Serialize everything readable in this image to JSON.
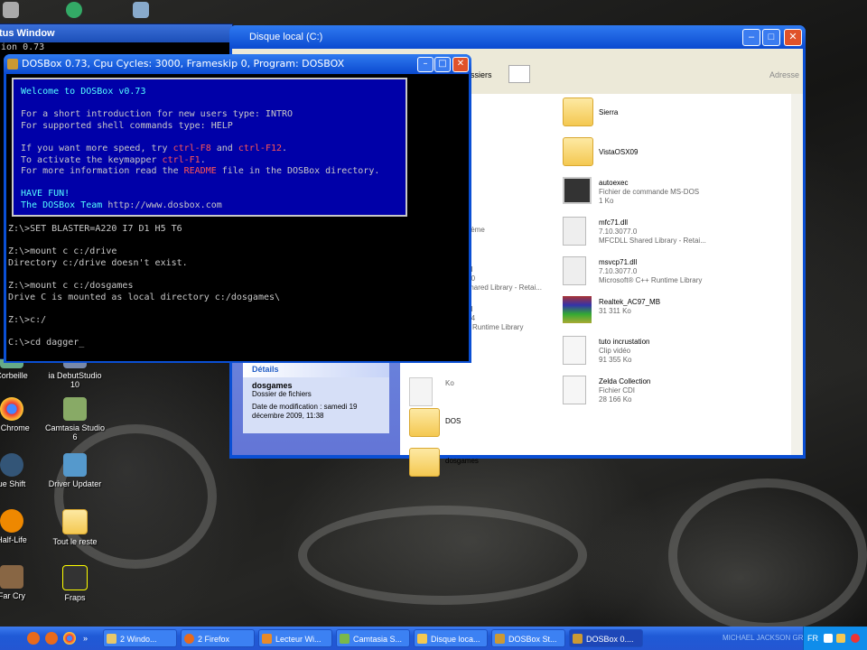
{
  "status_window": {
    "title": "tus Window",
    "line": "ion 0.73"
  },
  "explorer": {
    "title": "Disque local  (C:)",
    "toolbar": {
      "folders_label": "ssiers",
      "address_label": "Adresse"
    },
    "details": {
      "header": "Détails",
      "name": "dosgames",
      "type": "Dossier de fichiers",
      "modified": "Date de modification : samedi 19 décembre 2009, 11:38"
    },
    "left_files": [
      {
        "name": "",
        "line2": "stème",
        "line3": ""
      },
      {
        "name": "dll",
        "line2": "7.0",
        "line3": "Shared Library - Retai..."
      },
      {
        "name": "dll",
        "line2": "2.4",
        "line3": "C Runtime Library"
      },
      {
        "name": "",
        "line2": "Ko",
        "line3": ""
      },
      {
        "name": "DOS",
        "line2": "",
        "line3": ""
      },
      {
        "name": "dosgames",
        "line2": "",
        "line3": ""
      }
    ],
    "right_files": [
      {
        "name": "Sierra",
        "line2": "",
        "line3": "",
        "icon": "folder-icon"
      },
      {
        "name": "VistaOSX09",
        "line2": "",
        "line3": "",
        "icon": "folder-icon"
      },
      {
        "name": "autoexec",
        "line2": "Fichier de commande MS-DOS",
        "line3": "1 Ko",
        "icon": "batch-file-icon"
      },
      {
        "name": "mfc71.dll",
        "line2": "7.10.3077.0",
        "line3": "MFCDLL Shared Library - Retai...",
        "icon": "dll-icon"
      },
      {
        "name": "msvcp71.dll",
        "line2": "7.10.3077.0",
        "line3": "Microsoft® C++ Runtime Library",
        "icon": "dll-icon"
      },
      {
        "name": "Realtek_AC97_MB",
        "line2": "31 311 Ko",
        "line3": "",
        "icon": "rar-icon"
      },
      {
        "name": "tuto incrustation",
        "line2": "Clip vidéo",
        "line3": "91 355 Ko",
        "icon": "avi-icon"
      },
      {
        "name": "Zelda Collection",
        "line2": "Fichier CDI",
        "line3": "28 166 Ko",
        "icon": "cdi-icon"
      }
    ]
  },
  "dosbox": {
    "title": "DOSBox 0.73, Cpu Cycles:     3000, Frameskip  0, Program:  DOSBOX",
    "welcome": {
      "l1": "Welcome to DOSBox v0.73",
      "l2": "For a short introduction for new users type: INTRO",
      "l3": "For supported shell commands type: HELP",
      "l4a": "If you want more speed, try ",
      "l4b": "ctrl-F8",
      "l4c": " and ",
      "l4d": "ctrl-F12",
      "l4e": ".",
      "l5a": "To activate the keymapper ",
      "l5b": "ctrl-F1",
      "l5c": ".",
      "l6a": "For more information read the ",
      "l6b": "README",
      "l6c": " file in the DOSBox directory.",
      "l7": "HAVE FUN!",
      "l8a": "The DOSBox Team ",
      "l8b": "http://www.dosbox.com"
    },
    "commands": [
      "Z:\\>SET BLASTER=A220 I7 D1 H5 T6",
      "",
      "Z:\\>mount c c:/drive",
      "Directory c:/drive doesn't exist.",
      "",
      "Z:\\>mount c c:/dosgames",
      "Drive C is mounted as local directory c:/dosgames\\",
      "",
      "Z:\\>c:/",
      "",
      "C:\\>cd dagger_"
    ]
  },
  "desktop_icons": [
    {
      "label": "Corbeille"
    },
    {
      "label": "ia DebutStudio 10"
    },
    {
      "label": "e Chrome"
    },
    {
      "label": "Camtasia Studio 6"
    },
    {
      "label": "ue Shift"
    },
    {
      "label": "Driver Updater"
    },
    {
      "label": "Half-Life"
    },
    {
      "label": "Tout le reste"
    },
    {
      "label": "Far Cry"
    },
    {
      "label": "Fraps"
    }
  ],
  "taskbar": {
    "items": [
      {
        "label": "2 Windo..."
      },
      {
        "label": "2 Firefox"
      },
      {
        "label": "Lecteur Wi..."
      },
      {
        "label": "Camtasia S..."
      },
      {
        "label": "Disque loca..."
      },
      {
        "label": "DOSBox St..."
      },
      {
        "label": "DOSBox 0...."
      },
      {
        "label": "MICHAEL JACKSON GREATEST HITS"
      }
    ],
    "lang": "FR"
  }
}
